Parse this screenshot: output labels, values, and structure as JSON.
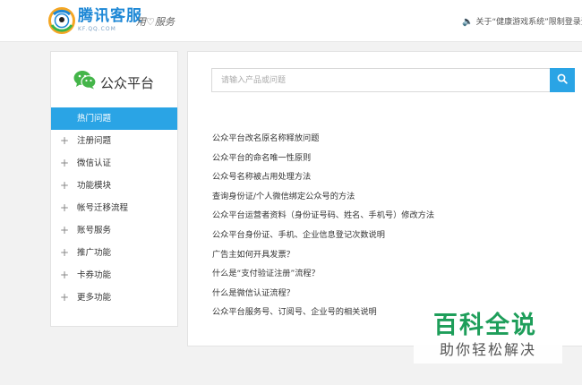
{
  "header": {
    "brand_title": "腾讯客服",
    "brand_sub": "KF.QQ.COM",
    "slogan": "用♡服务",
    "notice": "关于“健康游戏系统”限制登录资"
  },
  "sidebar": {
    "title": "公众平台",
    "items": [
      {
        "label": "热门问题",
        "active": true
      },
      {
        "label": "注册问题",
        "icon": "plus"
      },
      {
        "label": "微信认证",
        "icon": "plus"
      },
      {
        "label": "功能模块",
        "icon": "plus"
      },
      {
        "label": "帐号迁移流程",
        "icon": "plus"
      },
      {
        "label": "账号服务",
        "icon": "plus"
      },
      {
        "label": "推广功能",
        "icon": "plus"
      },
      {
        "label": "卡券功能",
        "icon": "plus"
      },
      {
        "label": "更多功能",
        "icon": "plus"
      }
    ]
  },
  "search": {
    "placeholder": "请输入产品或问题",
    "value": ""
  },
  "questions": [
    "公众平台改名原名称释放问题",
    "公众平台的命名唯一性原则",
    "公众号名称被占用处理方法",
    "查询身份证/个人微信绑定公众号的方法",
    "公众平台运营者资料（身份证号码、姓名、手机号）修改方法",
    "公众平台身份证、手机、企业信息登记次数说明",
    "广告主如何开具发票？",
    "什么是“支付验证注册”流程？",
    "什么是微信认证流程？",
    "公众平台服务号、订阅号、企业号的相关说明"
  ],
  "watermark": {
    "big": "百科全说",
    "small": "助你轻松解决"
  },
  "colors": {
    "accent": "#2aa4e5",
    "brand": "#1e88d6",
    "wechat_green": "#44b549",
    "watermark_green": "#1e9e5a"
  },
  "icons": [
    "qq-logo-icon",
    "speaker-icon",
    "wechat-icon",
    "plus-icon",
    "search-icon"
  ]
}
